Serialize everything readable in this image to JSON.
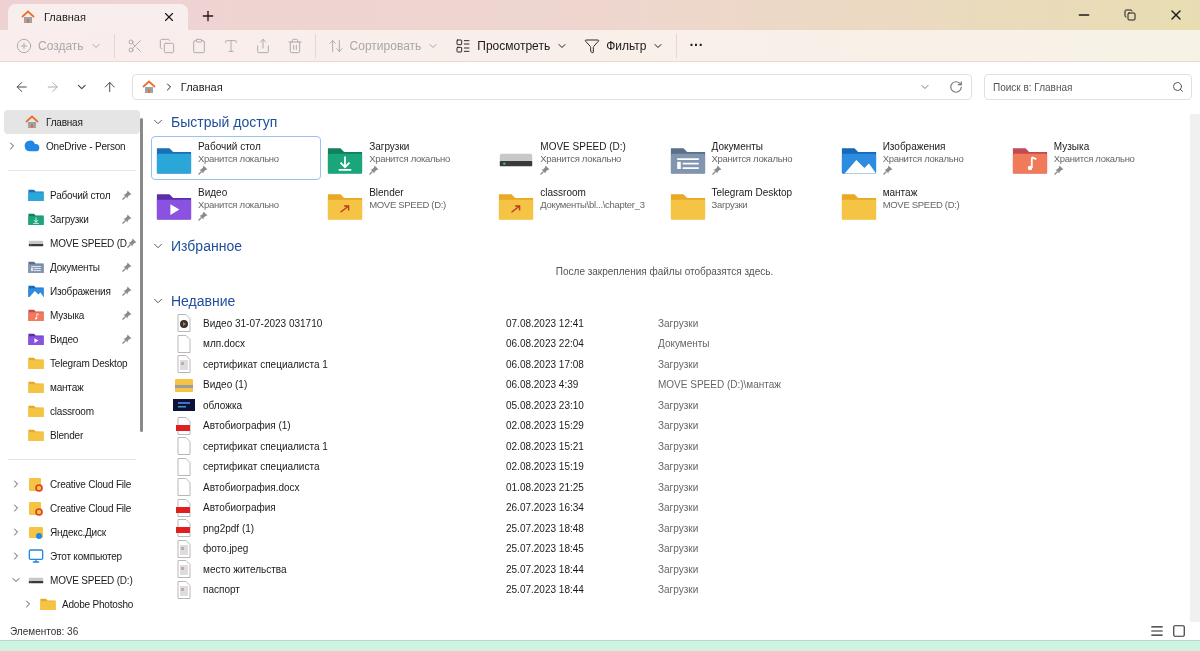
{
  "tabs": [
    {
      "label": "Главная",
      "selected": true
    }
  ],
  "toolbar": {
    "items": [
      {
        "kind": "new",
        "label": "Создать",
        "disabled": true
      },
      {
        "kind": "cut",
        "disabled": true
      },
      {
        "kind": "copy",
        "disabled": true
      },
      {
        "kind": "paste",
        "disabled": true
      },
      {
        "kind": "rename",
        "disabled": true
      },
      {
        "kind": "share",
        "disabled": true
      },
      {
        "kind": "delete",
        "disabled": true
      },
      {
        "kind": "sort",
        "label": "Сортировать",
        "disabled": true
      },
      {
        "kind": "view",
        "label": "Просмотреть",
        "disabled": false
      },
      {
        "kind": "filter",
        "label": "Фильтр",
        "disabled": false
      },
      {
        "kind": "more",
        "label": "···",
        "disabled": false
      }
    ]
  },
  "address": {
    "crumb": "Главная"
  },
  "search": {
    "placeholder": "Поиск в: Главная"
  },
  "sidebar": {
    "groups": [
      [
        {
          "label": "Главная",
          "kind": "home",
          "selected": true
        },
        {
          "label": "OneDrive - Person",
          "kind": "cloud",
          "selected": false,
          "expanded": false
        }
      ],
      [
        {
          "label": "Рабочий стол",
          "kind": "desktop",
          "selected": false,
          "pinned": true
        },
        {
          "label": "Загрузки",
          "kind": "download",
          "selected": false,
          "pinned": true
        },
        {
          "label": "MOVE SPEED (D",
          "kind": "drive",
          "selected": false,
          "pinned": true
        },
        {
          "label": "Документы",
          "kind": "documents",
          "selected": false,
          "pinned": true
        },
        {
          "label": "Изображения",
          "kind": "pictures",
          "selected": false,
          "pinned": true
        },
        {
          "label": "Музыка",
          "kind": "music",
          "selected": false,
          "pinned": true
        },
        {
          "label": "Видео",
          "kind": "video",
          "selected": false,
          "pinned": true
        },
        {
          "label": "Telegram Desktop",
          "kind": "folder",
          "selected": false,
          "pinned": false
        },
        {
          "label": "мантаж",
          "kind": "folder",
          "selected": false,
          "pinned": false
        },
        {
          "label": "classroom",
          "kind": "folder",
          "selected": false,
          "pinned": false
        },
        {
          "label": "Blender",
          "kind": "folder",
          "selected": false,
          "pinned": false
        }
      ],
      [
        {
          "label": "Creative Cloud File",
          "kind": "cc",
          "selected": false,
          "expanded": false
        },
        {
          "label": "Creative Cloud File",
          "kind": "cc",
          "selected": false,
          "expanded": false
        },
        {
          "label": "Яндекс.Диск",
          "kind": "yandex",
          "selected": false,
          "expanded": false
        },
        {
          "label": "Этот компьютер",
          "kind": "pc",
          "selected": false,
          "expanded": false
        },
        {
          "label": "MOVE SPEED (D:)",
          "kind": "drive",
          "selected": false,
          "expanded": true,
          "children": [
            {
              "label": "Adobe Photosho",
              "kind": "folder",
              "selected": false,
              "expanded": false
            }
          ]
        }
      ]
    ]
  },
  "quick_access": {
    "title": "Быстрый доступ",
    "expanded": true,
    "items": [
      {
        "name": "Рабочий стол",
        "location": "Хранится локально",
        "kind": "desktop",
        "pinned": true,
        "selected": true
      },
      {
        "name": "Загрузки",
        "location": "Хранится локально",
        "kind": "download",
        "pinned": true,
        "selected": false
      },
      {
        "name": "MOVE SPEED (D:)",
        "location": "Хранится локально",
        "kind": "drive",
        "pinned": true,
        "selected": false
      },
      {
        "name": "Документы",
        "location": "Хранится локально",
        "kind": "documents",
        "pinned": true,
        "selected": false
      },
      {
        "name": "Изображения",
        "location": "Хранится локально",
        "kind": "pictures",
        "pinned": true,
        "selected": false
      },
      {
        "name": "Музыка",
        "location": "Хранится локально",
        "kind": "music",
        "pinned": true,
        "selected": false
      },
      {
        "name": "Видео",
        "location": "Хранится локально",
        "kind": "video",
        "pinned": true,
        "selected": false
      },
      {
        "name": "Blender",
        "location": "MOVE SPEED (D:)",
        "kind": "shortcut",
        "pinned": false,
        "selected": false
      },
      {
        "name": "classroom",
        "location": "Документы\\bl...\\chapter_3",
        "kind": "shortcut",
        "pinned": false,
        "selected": false
      },
      {
        "name": "Telegram Desktop",
        "location": "Загрузки",
        "kind": "folder",
        "pinned": false,
        "selected": false
      },
      {
        "name": "мантаж",
        "location": "MOVE SPEED (D:)",
        "kind": "folder",
        "pinned": false,
        "selected": false
      }
    ]
  },
  "favorites": {
    "title": "Избранное",
    "expanded": true,
    "empty_message": "После закрепления файлы отобразятся здесь."
  },
  "recent": {
    "title": "Недавние",
    "expanded": true,
    "rows": [
      {
        "name": "Видео 31-07-2023 031710",
        "date": "07.08.2023 12:41",
        "location": "Загрузки",
        "kind": "video"
      },
      {
        "name": "млп.docx",
        "date": "06.08.2023 22:04",
        "location": "Документы",
        "kind": "file"
      },
      {
        "name": "сертификат специалиста 1",
        "date": "06.08.2023 17:08",
        "location": "Загрузки",
        "kind": "scan"
      },
      {
        "name": "Видео (1)",
        "date": "06.08.2023 4:39",
        "location": "MOVE SPEED (D:)\\мантаж",
        "kind": "zip"
      },
      {
        "name": "обложка",
        "date": "05.08.2023 23:10",
        "location": "Загрузки",
        "kind": "thumb"
      },
      {
        "name": "Автобиография (1)",
        "date": "02.08.2023 15:29",
        "location": "Загрузки",
        "kind": "pdf"
      },
      {
        "name": "сертификат специалиста 1",
        "date": "02.08.2023 15:21",
        "location": "Загрузки",
        "kind": "file"
      },
      {
        "name": "сертификат специалиста",
        "date": "02.08.2023 15:19",
        "location": "Загрузки",
        "kind": "file"
      },
      {
        "name": "Автобиография.docx",
        "date": "01.08.2023 21:25",
        "location": "Загрузки",
        "kind": "file"
      },
      {
        "name": "Автобиография",
        "date": "26.07.2023 16:34",
        "location": "Загрузки",
        "kind": "pdf"
      },
      {
        "name": "png2pdf (1)",
        "date": "25.07.2023 18:48",
        "location": "Загрузки",
        "kind": "pdf"
      },
      {
        "name": "фото.jpeg",
        "date": "25.07.2023 18:45",
        "location": "Загрузки",
        "kind": "scan"
      },
      {
        "name": "место жительства",
        "date": "25.07.2023 18:44",
        "location": "Загрузки",
        "kind": "scan"
      },
      {
        "name": "паспорт",
        "date": "25.07.2023 18:44",
        "location": "Загрузки",
        "kind": "scan"
      }
    ]
  },
  "status_bar": {
    "count": "Элементов: 36"
  }
}
